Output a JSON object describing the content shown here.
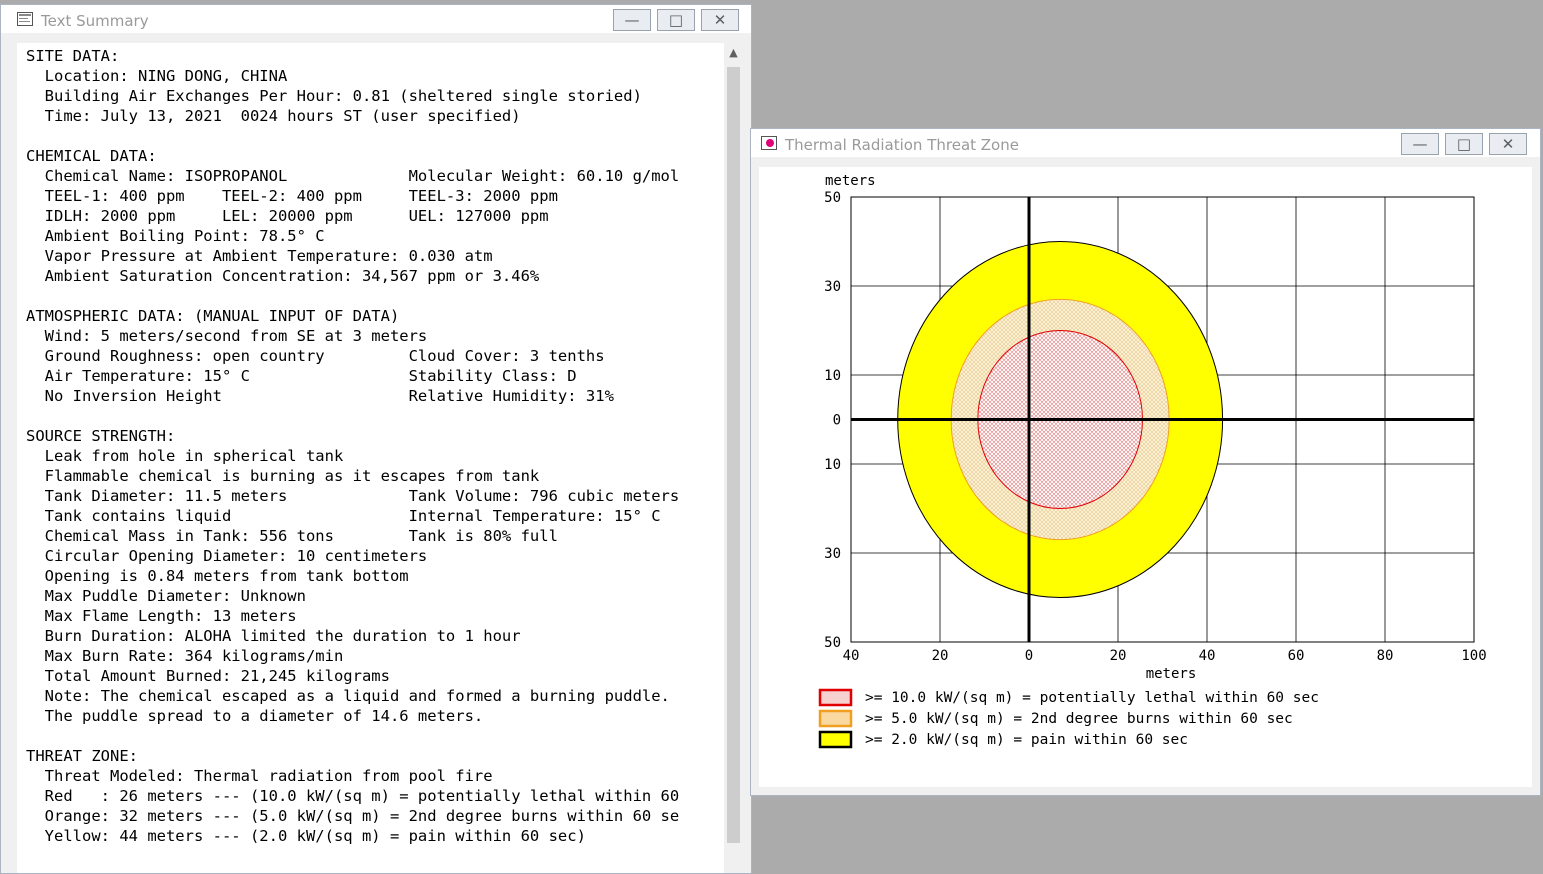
{
  "text_window": {
    "title": "Text Summary",
    "lines": [
      "SITE DATA:",
      "  Location: NING DONG, CHINA",
      "  Building Air Exchanges Per Hour: 0.81 (sheltered single storied)",
      "  Time: July 13, 2021  0024 hours ST (user specified)",
      "",
      "CHEMICAL DATA:",
      "  Chemical Name: ISOPROPANOL             Molecular Weight: 60.10 g/mol",
      "  TEEL-1: 400 ppm    TEEL-2: 400 ppm     TEEL-3: 2000 ppm",
      "  IDLH: 2000 ppm     LEL: 20000 ppm      UEL: 127000 ppm",
      "  Ambient Boiling Point: 78.5° C",
      "  Vapor Pressure at Ambient Temperature: 0.030 atm",
      "  Ambient Saturation Concentration: 34,567 ppm or 3.46%",
      "",
      "ATMOSPHERIC DATA: (MANUAL INPUT OF DATA)",
      "  Wind: 5 meters/second from SE at 3 meters",
      "  Ground Roughness: open country         Cloud Cover: 3 tenths",
      "  Air Temperature: 15° C                 Stability Class: D",
      "  No Inversion Height                    Relative Humidity: 31%",
      "",
      "SOURCE STRENGTH:",
      "  Leak from hole in spherical tank",
      "  Flammable chemical is burning as it escapes from tank",
      "  Tank Diameter: 11.5 meters             Tank Volume: 796 cubic meters",
      "  Tank contains liquid                   Internal Temperature: 15° C",
      "  Chemical Mass in Tank: 556 tons        Tank is 80% full",
      "  Circular Opening Diameter: 10 centimeters",
      "  Opening is 0.84 meters from tank bottom",
      "  Max Puddle Diameter: Unknown",
      "  Max Flame Length: 13 meters",
      "  Burn Duration: ALOHA limited the duration to 1 hour",
      "  Max Burn Rate: 364 kilograms/min",
      "  Total Amount Burned: 21,245 kilograms",
      "  Note: The chemical escaped as a liquid and formed a burning puddle.",
      "  The puddle spread to a diameter of 14.6 meters.",
      "",
      "THREAT ZONE:",
      "  Threat Modeled: Thermal radiation from pool fire",
      "  Red   : 26 meters --- (10.0 kW/(sq m) = potentially lethal within 60",
      "  Orange: 32 meters --- (5.0 kW/(sq m) = 2nd degree burns within 60 se",
      "  Yellow: 44 meters --- (2.0 kW/(sq m) = pain within 60 sec)"
    ]
  },
  "chart_window": {
    "title": "Thermal Radiation Threat Zone"
  },
  "window_controls": {
    "minimize": "—",
    "maximize": "□",
    "close": "✕"
  },
  "chart_data": {
    "type": "threat-zone",
    "ylabel": "meters",
    "xlabel": "meters",
    "x_ticks": [
      "40",
      "20",
      "0",
      "20",
      "40",
      "60",
      "80",
      "100"
    ],
    "x_tick_values": [
      -40,
      -20,
      0,
      20,
      40,
      60,
      80,
      100
    ],
    "y_ticks": [
      "50",
      "30",
      "10",
      "0",
      "10",
      "30",
      "50"
    ],
    "y_tick_values": [
      50,
      30,
      10,
      0,
      -10,
      -30,
      -50
    ],
    "xlim": [
      -40,
      100
    ],
    "ylim": [
      -50,
      50
    ],
    "grid": true,
    "zones": [
      {
        "name": "yellow",
        "cx": 7,
        "rx": 36.5,
        "ry": 40,
        "fill": "#ffff00",
        "stroke": "#000000",
        "pattern": "none"
      },
      {
        "name": "orange",
        "cx": 7,
        "rx": 24.5,
        "ry": 27,
        "fill": "#fbf0d0",
        "stroke": "#f0a020",
        "pattern": "orange-dots"
      },
      {
        "name": "red",
        "cx": 7,
        "rx": 18.5,
        "ry": 20,
        "fill": "#fff4f4",
        "stroke": "#e00000",
        "pattern": "red-dots"
      }
    ],
    "legend": [
      {
        "label": ">= 10.0 kW/(sq m) = potentially lethal within 60 sec",
        "color": "#e00000",
        "fill": "#f7d0d0"
      },
      {
        "label": ">= 5.0 kW/(sq m) = 2nd degree burns within 60 sec",
        "color": "#f0a020",
        "fill": "#f9d9a0"
      },
      {
        "label": ">= 2.0 kW/(sq m) = pain within 60 sec",
        "color": "#000000",
        "fill": "#ffff00"
      }
    ]
  }
}
